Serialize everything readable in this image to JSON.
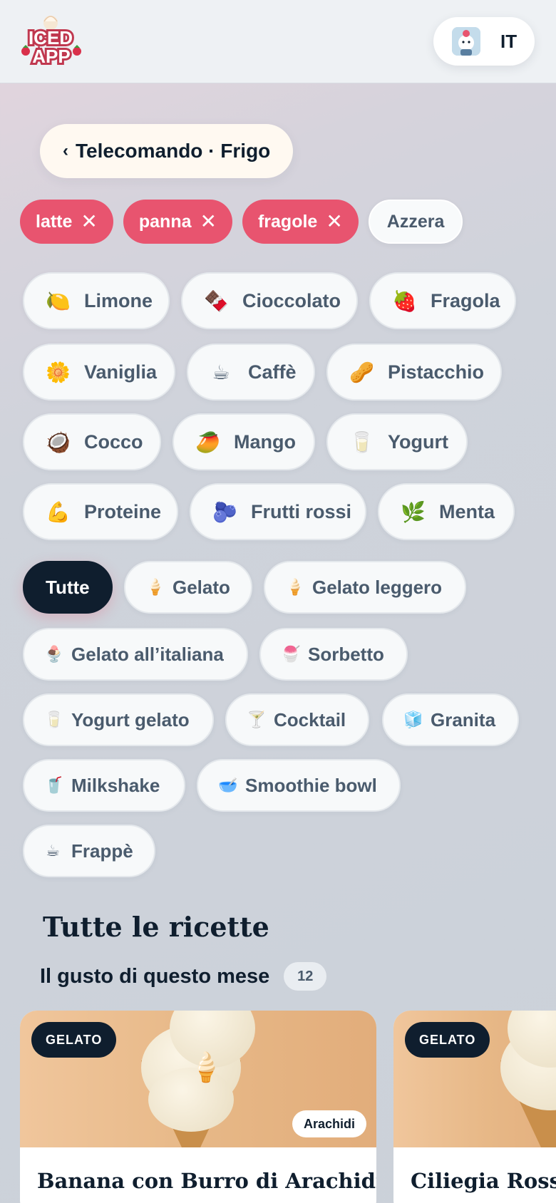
{
  "header": {
    "logo_text_line1": "ICED",
    "logo_text_line2": "APP",
    "language": "IT"
  },
  "breadcrumb": {
    "chevron": "‹",
    "label": "Telecomando · Frigo"
  },
  "active_filters": [
    {
      "label": "latte",
      "remove": "✕"
    },
    {
      "label": "panna",
      "remove": "✕"
    },
    {
      "label": "fragole",
      "remove": "✕"
    }
  ],
  "reset_label": "Azzera",
  "flavors": [
    {
      "icon": "🍋",
      "icon_name": "lemon-icon",
      "label": "Limone"
    },
    {
      "icon": "🍫",
      "icon_name": "chocolate-icon",
      "label": "Cioccolato"
    },
    {
      "icon": "🍓",
      "icon_name": "strawberry-icon",
      "label": "Fragola"
    },
    {
      "icon": "🌼",
      "icon_name": "flower-icon",
      "label": "Vaniglia"
    },
    {
      "icon": "☕",
      "icon_name": "coffee-icon",
      "label": "Caffè"
    },
    {
      "icon": "🥜",
      "icon_name": "peanut-icon",
      "label": "Pistacchio"
    },
    {
      "icon": "🥥",
      "icon_name": "coconut-icon",
      "label": "Cocco"
    },
    {
      "icon": "🥭",
      "icon_name": "mango-icon",
      "label": "Mango"
    },
    {
      "icon": "🥛",
      "icon_name": "milk-glass-icon",
      "label": "Yogurt"
    },
    {
      "icon": "💪",
      "icon_name": "flexed-bicep-icon",
      "label": "Proteine"
    },
    {
      "icon": "🫐",
      "icon_name": "blueberries-icon",
      "label": "Frutti rossi"
    },
    {
      "icon": "🌿",
      "icon_name": "herb-icon",
      "label": "Menta"
    }
  ],
  "categories": [
    {
      "icon": "",
      "icon_name": "",
      "label": "Tutte",
      "active": true
    },
    {
      "icon": "🍦",
      "icon_name": "ice-cream-cone-icon",
      "label": "Gelato"
    },
    {
      "icon": "🍦",
      "icon_name": "ice-cream-cone-icon",
      "label": "Gelato leggero"
    },
    {
      "icon": "🍨",
      "icon_name": "ice-cream-cup-icon",
      "label": "Gelato all’italiana"
    },
    {
      "icon": "🍧",
      "icon_name": "shaved-ice-icon",
      "label": "Sorbetto"
    },
    {
      "icon": "🥛",
      "icon_name": "milk-glass-icon",
      "label": "Yogurt gelato"
    },
    {
      "icon": "🍸",
      "icon_name": "cocktail-glass-icon",
      "label": "Cocktail"
    },
    {
      "icon": "🧊",
      "icon_name": "ice-cube-icon",
      "label": "Granita"
    },
    {
      "icon": "🥤",
      "icon_name": "cup-with-straw-icon",
      "label": "Milkshake"
    },
    {
      "icon": "🥣",
      "icon_name": "bowl-icon",
      "label": "Smoothie bowl"
    },
    {
      "icon": "☕",
      "icon_name": "coffee-icon",
      "label": "Frappè"
    }
  ],
  "section": {
    "title": "Tutte le ricette",
    "subtitle": "Il gusto di questo mese",
    "count": "12"
  },
  "recipes": [
    {
      "badge": "GELATO",
      "tag": "Arachidi",
      "title": "Banana con Burro di Arachidi"
    },
    {
      "badge": "GELATO",
      "tag": "",
      "title": "Ciliegia Rossa"
    }
  ],
  "colors": {
    "accent": "#e8546f",
    "dark": "#0f1e2e",
    "muted_text": "#4a5b6d"
  }
}
